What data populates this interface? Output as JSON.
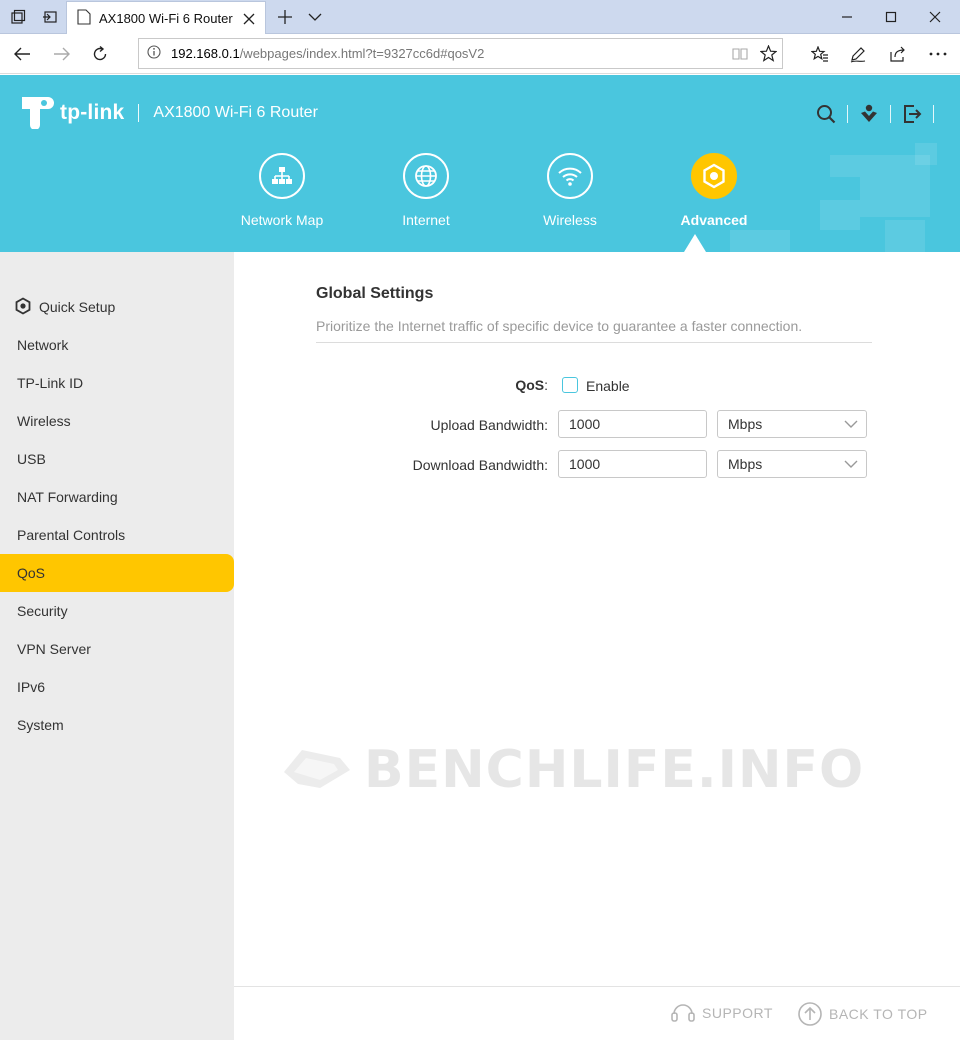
{
  "browser": {
    "tab_title": "AX1800 Wi-Fi 6 Router",
    "url_host": "192.168.0.1",
    "url_path": "/webpages/index.html?t=9327cc6d#qosV2"
  },
  "header": {
    "logo_text": "tp-link",
    "model_name": "AX1800 Wi-Fi 6 Router",
    "nav": [
      {
        "label": "Network Map",
        "icon": "network-map-icon"
      },
      {
        "label": "Internet",
        "icon": "globe-icon"
      },
      {
        "label": "Wireless",
        "icon": "wifi-icon"
      },
      {
        "label": "Advanced",
        "icon": "gear-icon",
        "active": true
      }
    ]
  },
  "sidebar": {
    "items": [
      {
        "label": "Quick Setup"
      },
      {
        "label": "Network"
      },
      {
        "label": "TP-Link ID"
      },
      {
        "label": "Wireless"
      },
      {
        "label": "USB"
      },
      {
        "label": "NAT Forwarding"
      },
      {
        "label": "Parental Controls"
      },
      {
        "label": "QoS",
        "active": true
      },
      {
        "label": "Security"
      },
      {
        "label": "VPN Server"
      },
      {
        "label": "IPv6"
      },
      {
        "label": "System"
      }
    ]
  },
  "main": {
    "title": "Global Settings",
    "description": "Prioritize the Internet traffic of specific device to guarantee a faster connection.",
    "qos_label": "QoS",
    "qos_colon": ":",
    "enable_label": "Enable",
    "upload_label": "Upload Bandwidth:",
    "upload_value": "1000",
    "upload_unit": "Mbps",
    "download_label": "Download Bandwidth:",
    "download_value": "1000",
    "download_unit": "Mbps"
  },
  "watermark": "BENCHLIFE.INFO",
  "footer": {
    "support_label": "SUPPORT",
    "back_to_top_label": "BACK TO TOP"
  },
  "colors": {
    "header_bg": "#4ac6de",
    "accent": "#ffc600",
    "sidebar_bg": "#ececec"
  }
}
